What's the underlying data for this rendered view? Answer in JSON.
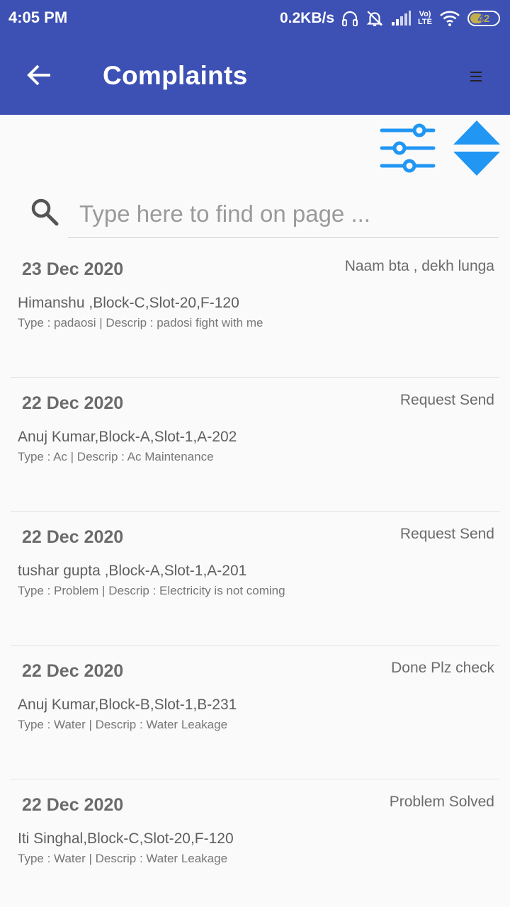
{
  "status_bar": {
    "time": "4:05 PM",
    "net_speed": "0.2KB/s",
    "lte_top": "Vo)",
    "lte_bottom": "LTE",
    "battery": "42"
  },
  "header": {
    "title": "Complaints"
  },
  "search": {
    "placeholder": "Type here to find on page ..."
  },
  "colors": {
    "appbar": "#3d51b4",
    "accent": "#2196f3",
    "background": "#fafafa"
  },
  "complaints": [
    {
      "date": "23 Dec 2020",
      "status": "Naam bta , dekh lunga",
      "name": "Himanshu ,Block-C,Slot-20,F-120",
      "desc": "Type : padaosi | Descrip : padosi fight with me"
    },
    {
      "date": "22 Dec 2020",
      "status": "Request Send",
      "name": "Anuj Kumar,Block-A,Slot-1,A-202",
      "desc": "Type : Ac | Descrip : Ac Maintenance"
    },
    {
      "date": "22 Dec 2020",
      "status": "Request Send",
      "name": "tushar gupta ,Block-A,Slot-1,A-201",
      "desc": "Type : Problem | Descrip : Electricity is not coming"
    },
    {
      "date": "22 Dec 2020",
      "status": "Done Plz check",
      "name": "Anuj  Kumar,Block-B,Slot-1,B-231",
      "desc": "Type : Water | Descrip : Water Leakage"
    },
    {
      "date": "22 Dec 2020",
      "status": "Problem Solved",
      "name": "Iti Singhal,Block-C,Slot-20,F-120",
      "desc": "Type : Water | Descrip : Water Leakage"
    }
  ]
}
